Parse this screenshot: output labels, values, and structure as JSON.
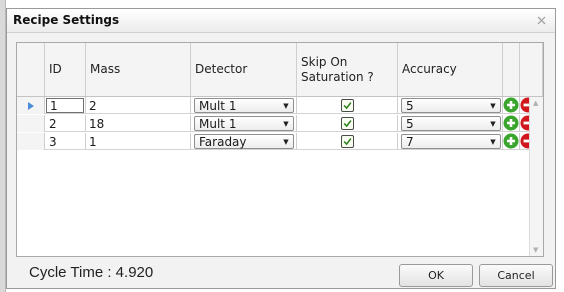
{
  "window": {
    "title": "Recipe Settings",
    "close_icon": "close-icon"
  },
  "grid": {
    "columns": {
      "id": "ID",
      "mass": "Mass",
      "detector": "Detector",
      "skip_line1": "Skip On",
      "skip_line2": "Saturation ?",
      "accuracy": "Accuracy"
    },
    "rows": [
      {
        "id": "1",
        "mass": "2",
        "detector": "Mult 1",
        "skip": true,
        "accuracy": "5"
      },
      {
        "id": "2",
        "mass": "18",
        "detector": "Mult 1",
        "skip": true,
        "accuracy": "5"
      },
      {
        "id": "3",
        "mass": "1",
        "detector": "Faraday",
        "skip": true,
        "accuracy": "7"
      }
    ],
    "row_icons": {
      "add": "add-icon",
      "remove": "remove-icon"
    }
  },
  "footer": {
    "cycle_time": "Cycle Time : 4.920",
    "ok_label": "OK",
    "cancel_label": "Cancel"
  },
  "colors": {
    "add_green": "#3aa52c",
    "remove_red": "#d0171b",
    "check_green": "#2e7d1e",
    "row_indicator": "#4a8fd6"
  }
}
